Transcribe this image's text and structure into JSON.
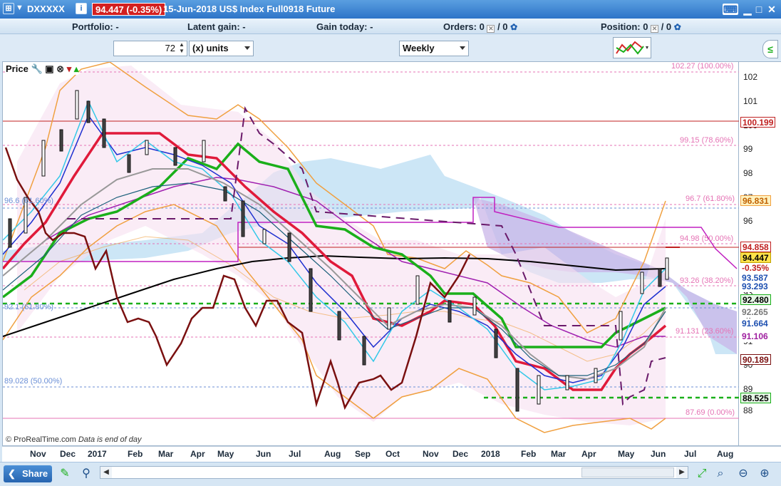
{
  "window": {
    "symbol": "DXXXXX",
    "price_badge": "94.447 (-0.35%)",
    "title": "15-Jun-2018 US$ Index Full0918 Future",
    "info_icon": "i"
  },
  "infobar": {
    "portfolio": "Portfolio: -",
    "latent_gain": "Latent gain: -",
    "gain_today": "Gain today: -",
    "orders_label": "Orders: 0",
    "orders_slash": "/ 0",
    "position_label": "Position: 0",
    "position_slash": "/ 0"
  },
  "toolbar": {
    "units_value": "72",
    "units_select": "(x) units",
    "timeframe": "Weekly"
  },
  "chart": {
    "panel_label": "Price",
    "copyright": "© ProRealTime.com",
    "status_note": "Data is end of day",
    "colors": {
      "up": "#d62828",
      "kijun": "#1aaf1a",
      "ma": "#000000",
      "bollinger": "#f0a040",
      "cloud_top": "#9ec9ea",
      "cloud_bottom": "#b39ddb",
      "chikou": "#7a1010"
    },
    "y_ticks": [
      "102",
      "101",
      "100",
      "99",
      "98",
      "97",
      "96",
      "95",
      "94",
      "93",
      "92",
      "91",
      "90",
      "89",
      "88"
    ],
    "fib_levels": [
      {
        "label": "102.27 (100.00%)",
        "color": "#e573b5"
      },
      {
        "label": "99.15 (78.60%)",
        "color": "#e573b5"
      },
      {
        "label": "96.7 (61.80%)",
        "color": "#e573b5"
      },
      {
        "label": "94.98 (50.00%)",
        "color": "#e573b5"
      },
      {
        "label": "93.26 (38.20%)",
        "color": "#e573b5"
      },
      {
        "label": "91.131 (23.60%)",
        "color": "#e573b5"
      },
      {
        "label": "87.69 (0.00%)",
        "color": "#e573b5"
      },
      {
        "label": "96.6 (61.60%)",
        "color": "#6b8fd6"
      },
      {
        "label": "92.1 (61.80%)",
        "color": "#6b8fd6"
      },
      {
        "label": "89.028 (50.00%)",
        "color": "#6b8fd6"
      }
    ],
    "price_tags": [
      {
        "value": "100.199",
        "bg": "#ffffff",
        "fg": "#c02020",
        "border": "#c02020"
      },
      {
        "value": "96.831",
        "bg": "#fff2c0",
        "fg": "#c06000",
        "border": "#f0a040"
      },
      {
        "value": "94.858",
        "bg": "#ffffff",
        "fg": "#c02020",
        "border": "#c02020"
      },
      {
        "value": "94.447",
        "bg": "#ffe24a",
        "fg": "#000000",
        "border": "#c0a000"
      },
      {
        "value": "-0.35%",
        "bg": "#ffffff",
        "fg": "#c02020",
        "border": "#ffffff"
      },
      {
        "value": "93.587",
        "bg": "#ffffff",
        "fg": "#1d4fb0",
        "border": "#ffffff"
      },
      {
        "value": "93.293",
        "bg": "#ffffff",
        "fg": "#1d4fb0",
        "border": "#ffffff"
      },
      {
        "value": "92.480",
        "bg": "#e6f7e6",
        "fg": "#000000",
        "border": "#1aaf1a"
      },
      {
        "value": "92.265",
        "bg": "#ffffff",
        "fg": "#777777",
        "border": "#ffffff"
      },
      {
        "value": "91.664",
        "bg": "#ffffff",
        "fg": "#1d4fb0",
        "border": "#ffffff"
      },
      {
        "value": "91.106",
        "bg": "#ffffff",
        "fg": "#a020a0",
        "border": "#ffffff"
      },
      {
        "value": "90.189",
        "bg": "#ffffff",
        "fg": "#7a1010",
        "border": "#7a1010"
      },
      {
        "value": "88.525",
        "bg": "#e6f7e6",
        "fg": "#000000",
        "border": "#1aaf1a"
      }
    ],
    "x_labels": [
      "Nov",
      "Dec",
      "2017",
      "Feb",
      "Mar",
      "Apr",
      "May",
      "Jun",
      "Jul",
      "Aug",
      "Sep",
      "Oct",
      "Nov",
      "Dec",
      "2018",
      "Feb",
      "Mar",
      "Apr",
      "May",
      "Jun",
      "Jul",
      "Aug"
    ]
  },
  "bottombar": {
    "share_label": "Share"
  }
}
